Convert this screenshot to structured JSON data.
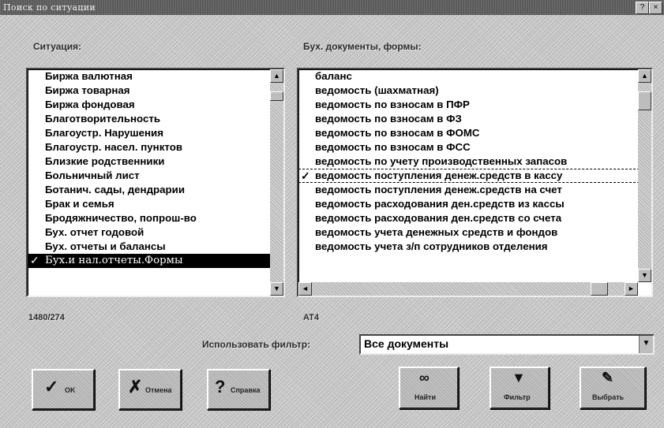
{
  "window": {
    "title": "Поиск по ситуации"
  },
  "labels": {
    "situations": "Ситуация:",
    "documents": "Бух. документы, формы:",
    "left_count": "1480/274",
    "right_count": "AT4"
  },
  "left_list": [
    "Биржа валютная",
    "Биржа товарная",
    "Биржа фондовая",
    "Благотворительность",
    "Благоустр. Нарушения",
    "Благоустр. насел. пунктов",
    "Близкие родственники",
    "Больничный лист",
    "Ботанич. сады, дендрарии",
    "Брак и семья",
    "Бродяжничество, попрош-во",
    "Бух. отчет годовой",
    "Бух. отчеты и балансы",
    "Бух.и нал.отчеты.Формы"
  ],
  "right_list": [
    "баланс",
    "ведомость (шахматная)",
    "ведомость по взносам в ПФР",
    "ведомость по взносам в ФЗ",
    "ведомость по взносам в ФОМС",
    "ведомость по взносам в ФСС",
    "ведомость по учету производственных запасов",
    "ведомость поступления денеж.средств в кассу",
    "ведомость поступления денеж.средств на счет",
    "ведомость расходования ден.средств из кассы",
    "ведомость расходования ден.средств со счета",
    "ведомость учета денежных средств и фондов",
    "ведомость учета з/п сотрудников отделения"
  ],
  "filter": {
    "label": "Использовать фильтр:",
    "value": "Все документы"
  },
  "buttons": {
    "ok": "OK",
    "cancel": "Отмена",
    "help": "Справка",
    "find": "Найти",
    "filter": "Фильтр",
    "select": "Выбрать"
  },
  "icons": {
    "check": "✓",
    "up": "▲",
    "down": "▼",
    "left": "◄",
    "right": "►"
  }
}
